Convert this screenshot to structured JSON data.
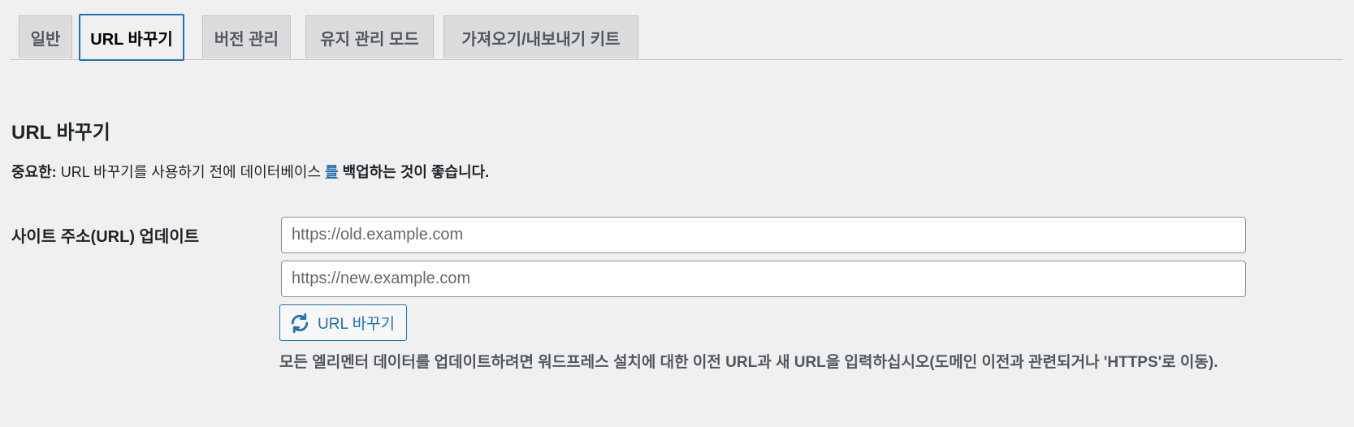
{
  "tabs": [
    {
      "label": "일반",
      "active": false
    },
    {
      "label": "URL 바꾸기",
      "active": true
    },
    {
      "label": "버전 관리",
      "active": false
    },
    {
      "label": "유지 관리 모드",
      "active": false
    },
    {
      "label": "가져오기/내보내기 키트",
      "active": false
    }
  ],
  "section": {
    "title": "URL 바꾸기"
  },
  "notice": {
    "prefix": "중요한:",
    "middle": "URL 바꾸기를 사용하기 전에 데이터베이스",
    "link": "를",
    "suffix": "백업하는 것이 좋습니다."
  },
  "form": {
    "row_label": "사이트 주소(URL) 업데이트",
    "old_url": {
      "value": "",
      "placeholder": "https://old.example.com"
    },
    "new_url": {
      "value": "",
      "placeholder": "https://new.example.com"
    },
    "button_label": "URL 바꾸기",
    "button_icon": "refresh-icon",
    "description": "모든 엘리멘터 데이터를 업데이트하려면 워드프레스 설치에 대한 이전 URL과 새 URL을 입력하십시오(도메인 이전과 관련되거나 'HTTPS'로 이동)."
  },
  "colors": {
    "accent": "#2271b1",
    "background": "#f0f0f1",
    "tab_inactive": "#dcdcde",
    "text": "#1d2327"
  }
}
